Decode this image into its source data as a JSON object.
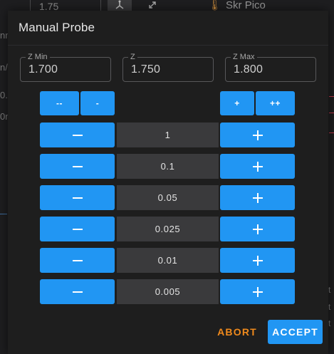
{
  "background": {
    "z_field_value": "1.75",
    "printer_name": "Skr Pico",
    "left_fragments": [
      "nn",
      "n/",
      "0.(",
      "0m"
    ],
    "right_fragments": [
      "t",
      "t",
      "t"
    ]
  },
  "dialog": {
    "title": "Manual Probe",
    "fields": {
      "z_min": {
        "label": "Z Min",
        "value": "1.700"
      },
      "z": {
        "label": "Z",
        "value": "1.750"
      },
      "z_max": {
        "label": "Z Max",
        "value": "1.800"
      }
    },
    "bisect": {
      "double_minus": "--",
      "minus": "-",
      "plus": "+",
      "double_plus": "++"
    },
    "steps": [
      "1",
      "0.1",
      "0.05",
      "0.025",
      "0.01",
      "0.005"
    ],
    "abort_label": "ABORT",
    "accept_label": "ACCEPT"
  },
  "colors": {
    "accent": "#2196f3",
    "warning": "#f08a1c",
    "surface": "#1e1e1e",
    "step_cell": "#3a3a3c"
  },
  "icons": [
    "axis-icon",
    "expand-icon",
    "thermometer-icon",
    "minus-icon",
    "plus-icon"
  ]
}
